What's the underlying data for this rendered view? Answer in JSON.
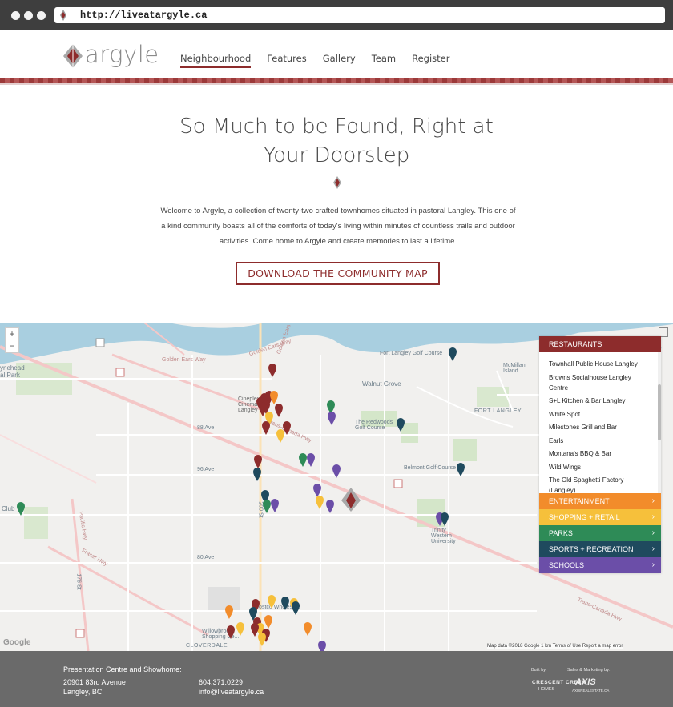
{
  "browser": {
    "url": "http://liveatargyle.ca"
  },
  "header": {
    "logo_text": "argyle",
    "nav": [
      {
        "label": "Neighbourhood",
        "active": true
      },
      {
        "label": "Features",
        "active": false
      },
      {
        "label": "Gallery",
        "active": false
      },
      {
        "label": "Team",
        "active": false
      },
      {
        "label": "Register",
        "active": false
      }
    ]
  },
  "hero": {
    "title_line1": "So Much to be Found, Right at",
    "title_line2": "Your Doorstep",
    "intro": "Welcome to Argyle, a collection of twenty-two crafted townhomes situated in pastoral Langley. This one of a kind community boasts all of the comforts of today's living within minutes of countless trails and outdoor activities. Come home to Argyle and create memories to last a lifetime.",
    "download_label": "DOWNLOAD THE COMMUNITY MAP"
  },
  "map": {
    "zoom_in": "+",
    "zoom_out": "−",
    "labels": {
      "golden_ears_way": "Golden Ears Way",
      "golden_ears_way2": "Golden Ears Way",
      "golden_ears_way3": "Golden Ears Way",
      "fort_langley_golf": "Fort Langley Golf Course",
      "mcmillan": "McMillan Island",
      "walnut_grove": "Walnut Grove",
      "fort_langley": "FORT LANGLEY",
      "redwoods": "The Redwoods Golf Course",
      "belmont": "Belmont Golf Course",
      "trinity": "Trinity Western University",
      "cineplex": "Cineplex Cinemas Langley",
      "trans_canada": "Trans-Canada Hwy",
      "trans_canada2": "Trans-Canada Hwy",
      "pacific_hwy": "Pacific Hwy",
      "fraser_hwy": "Fraser Hwy",
      "st_176": "176 St",
      "st_200": "200 St",
      "ave_88": "88 Ave",
      "ave_96": "96 Ave",
      "ave_80": "80 Ave",
      "club": "Club",
      "park": "ynehead\nal Park",
      "willowbrook": "Willowbrook Shopping Ce...",
      "costco": "Costco Wholesale",
      "cloverdale": "CLOVERDALE",
      "google": "Google"
    },
    "attribution": "Map data ©2018 Google    1 km                  Terms of Use    Report a map error"
  },
  "categories": {
    "restaurants": {
      "label": "RESTAURANTS",
      "color": "#8d2c2c"
    },
    "restaurant_list": [
      "Townhall Public House Langley",
      "Browns Socialhouse Langley Centre",
      "S+L Kitchen & Bar Langley",
      "White Spot",
      "Milestones Grill and Bar",
      "Earls",
      "Montana's BBQ & Bar",
      "Wild Wings",
      "The Old Spaghetti Factory (Langley)"
    ],
    "others": [
      {
        "label": "ENTERTAINMENT",
        "color": "#f28c2b"
      },
      {
        "label": "SHOPPING + RETAIL",
        "color": "#f6c03b"
      },
      {
        "label": "PARKS",
        "color": "#2e8b57"
      },
      {
        "label": "SPORTS + RECREATION",
        "color": "#1f4a5e"
      },
      {
        "label": "SCHOOLS",
        "color": "#6b4ea8"
      }
    ]
  },
  "footer": {
    "presentation_title": "Presentation Centre and Showhome:",
    "address_line1": "20901 83rd Avenue",
    "address_line2": "Langley, BC",
    "phone": "604.371.0229",
    "email": "info@liveatargyle.ca",
    "built_by": "Built by:",
    "marketing_by": "Sales & Marketing by:",
    "builder_name": "CRESCENT CREEK",
    "builder_sub": "HOMES",
    "marketer_name": "AXIS",
    "marketer_sub": "AXISREALESTATE.CA"
  },
  "pin_colors": {
    "restaurant": "#8d2c2c",
    "entertainment": "#f28c2b",
    "shopping": "#f6c03b",
    "parks": "#2e8b57",
    "sports": "#1f4a5e",
    "schools": "#6b4ea8"
  }
}
